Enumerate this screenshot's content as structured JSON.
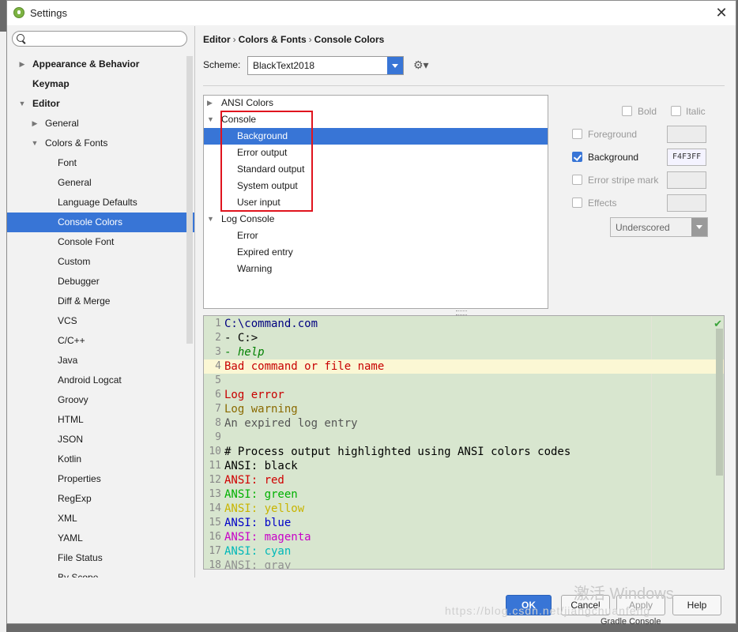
{
  "window": {
    "title": "Settings",
    "close_icon": "close-icon"
  },
  "search": {
    "value": "",
    "placeholder": ""
  },
  "sidebar": {
    "items": [
      {
        "label": "Appearance & Behavior",
        "arrow": "▶"
      },
      {
        "label": "Keymap",
        "arrow": ""
      },
      {
        "label": "Editor",
        "arrow": "▼"
      },
      {
        "label": "General",
        "arrow": "▶"
      },
      {
        "label": "Colors & Fonts",
        "arrow": "▼"
      },
      {
        "label": "Font",
        "arrow": ""
      },
      {
        "label": "General",
        "arrow": ""
      },
      {
        "label": "Language Defaults",
        "arrow": ""
      },
      {
        "label": "Console Colors",
        "arrow": ""
      },
      {
        "label": "Console Font",
        "arrow": ""
      },
      {
        "label": "Custom",
        "arrow": ""
      },
      {
        "label": "Debugger",
        "arrow": ""
      },
      {
        "label": "Diff & Merge",
        "arrow": ""
      },
      {
        "label": "VCS",
        "arrow": ""
      },
      {
        "label": "C/C++",
        "arrow": ""
      },
      {
        "label": "Java",
        "arrow": ""
      },
      {
        "label": "Android Logcat",
        "arrow": ""
      },
      {
        "label": "Groovy",
        "arrow": ""
      },
      {
        "label": "HTML",
        "arrow": ""
      },
      {
        "label": "JSON",
        "arrow": ""
      },
      {
        "label": "Kotlin",
        "arrow": ""
      },
      {
        "label": "Properties",
        "arrow": ""
      },
      {
        "label": "RegExp",
        "arrow": ""
      },
      {
        "label": "XML",
        "arrow": ""
      },
      {
        "label": "YAML",
        "arrow": ""
      },
      {
        "label": "File Status",
        "arrow": ""
      },
      {
        "label": "By Scope",
        "arrow": ""
      }
    ]
  },
  "breadcrumb": [
    "Editor",
    "Colors & Fonts",
    "Console Colors"
  ],
  "breadcrumb_sep": "›",
  "scheme": {
    "label": "Scheme:",
    "value": "BlackText2018",
    "gear_icon": "gear-icon"
  },
  "color_tree": [
    {
      "label": "ANSI Colors",
      "arrow": "▶"
    },
    {
      "label": "Console",
      "arrow": "▼"
    },
    {
      "label": "Background",
      "arrow": ""
    },
    {
      "label": "Error output",
      "arrow": ""
    },
    {
      "label": "Standard output",
      "arrow": ""
    },
    {
      "label": "System output",
      "arrow": ""
    },
    {
      "label": "User input",
      "arrow": ""
    },
    {
      "label": "Log Console",
      "arrow": "▼"
    },
    {
      "label": "Error",
      "arrow": ""
    },
    {
      "label": "Expired entry",
      "arrow": ""
    },
    {
      "label": "Warning",
      "arrow": ""
    }
  ],
  "attributes": {
    "bold": "Bold",
    "italic": "Italic",
    "foreground": "Foreground",
    "background": "Background",
    "background_value": "F4F3FF",
    "background_checked": true,
    "error_stripe": "Error stripe mark",
    "effects": "Effects",
    "effect_type": "Underscored"
  },
  "preview": {
    "lines": [
      {
        "n": "1",
        "segments": [
          {
            "t": "C:\\command.com",
            "c": "#000080"
          }
        ]
      },
      {
        "n": "2",
        "segments": [
          {
            "t": "- C:>",
            "c": "#000000"
          }
        ]
      },
      {
        "n": "3",
        "segments": [
          {
            "t": "- ",
            "c": "#008000"
          },
          {
            "t": "help",
            "c": "#008000",
            "italic": true
          }
        ]
      },
      {
        "n": "4",
        "segments": [
          {
            "t": "Bad command or file name",
            "c": "#c80000"
          }
        ]
      },
      {
        "n": "5",
        "segments": []
      },
      {
        "n": "6",
        "segments": [
          {
            "t": "Log error",
            "c": "#c80000"
          }
        ]
      },
      {
        "n": "7",
        "segments": [
          {
            "t": "Log warning",
            "c": "#8a6a00"
          }
        ]
      },
      {
        "n": "8",
        "segments": [
          {
            "t": "An expired log entry",
            "c": "#555555"
          }
        ]
      },
      {
        "n": "9",
        "segments": []
      },
      {
        "n": "10",
        "segments": [
          {
            "t": "# Process output highlighted using ANSI colors codes",
            "c": "#000000"
          }
        ]
      },
      {
        "n": "11",
        "segments": [
          {
            "t": "ANSI: black",
            "c": "#000000"
          }
        ]
      },
      {
        "n": "12",
        "segments": [
          {
            "t": "ANSI: red",
            "c": "#d00000"
          }
        ]
      },
      {
        "n": "13",
        "segments": [
          {
            "t": "ANSI: green",
            "c": "#00b000"
          }
        ]
      },
      {
        "n": "14",
        "segments": [
          {
            "t": "ANSI: yellow",
            "c": "#c8b400"
          }
        ]
      },
      {
        "n": "15",
        "segments": [
          {
            "t": "ANSI: blue",
            "c": "#0000c8"
          }
        ]
      },
      {
        "n": "16",
        "segments": [
          {
            "t": "ANSI: magenta",
            "c": "#c800c8"
          }
        ]
      },
      {
        "n": "17",
        "segments": [
          {
            "t": "ANSI: cyan",
            "c": "#00b8b8"
          }
        ]
      },
      {
        "n": "18",
        "segments": [
          {
            "t": "ANSI: gray",
            "c": "#909090"
          }
        ]
      }
    ],
    "highlighted_line": "4"
  },
  "buttons": {
    "ok": "OK",
    "cancel": "Cancel",
    "apply": "Apply",
    "help": "Help"
  },
  "watermark": {
    "line1": "激活 Windows",
    "line2": "https://blog.csdn.net/jiangchuanfeng"
  },
  "bottom_text": "Gradle Console",
  "colors": {
    "accent": "#3875d6",
    "preview_bg": "#d8e6cf",
    "highlight_box": "#e0141e"
  }
}
